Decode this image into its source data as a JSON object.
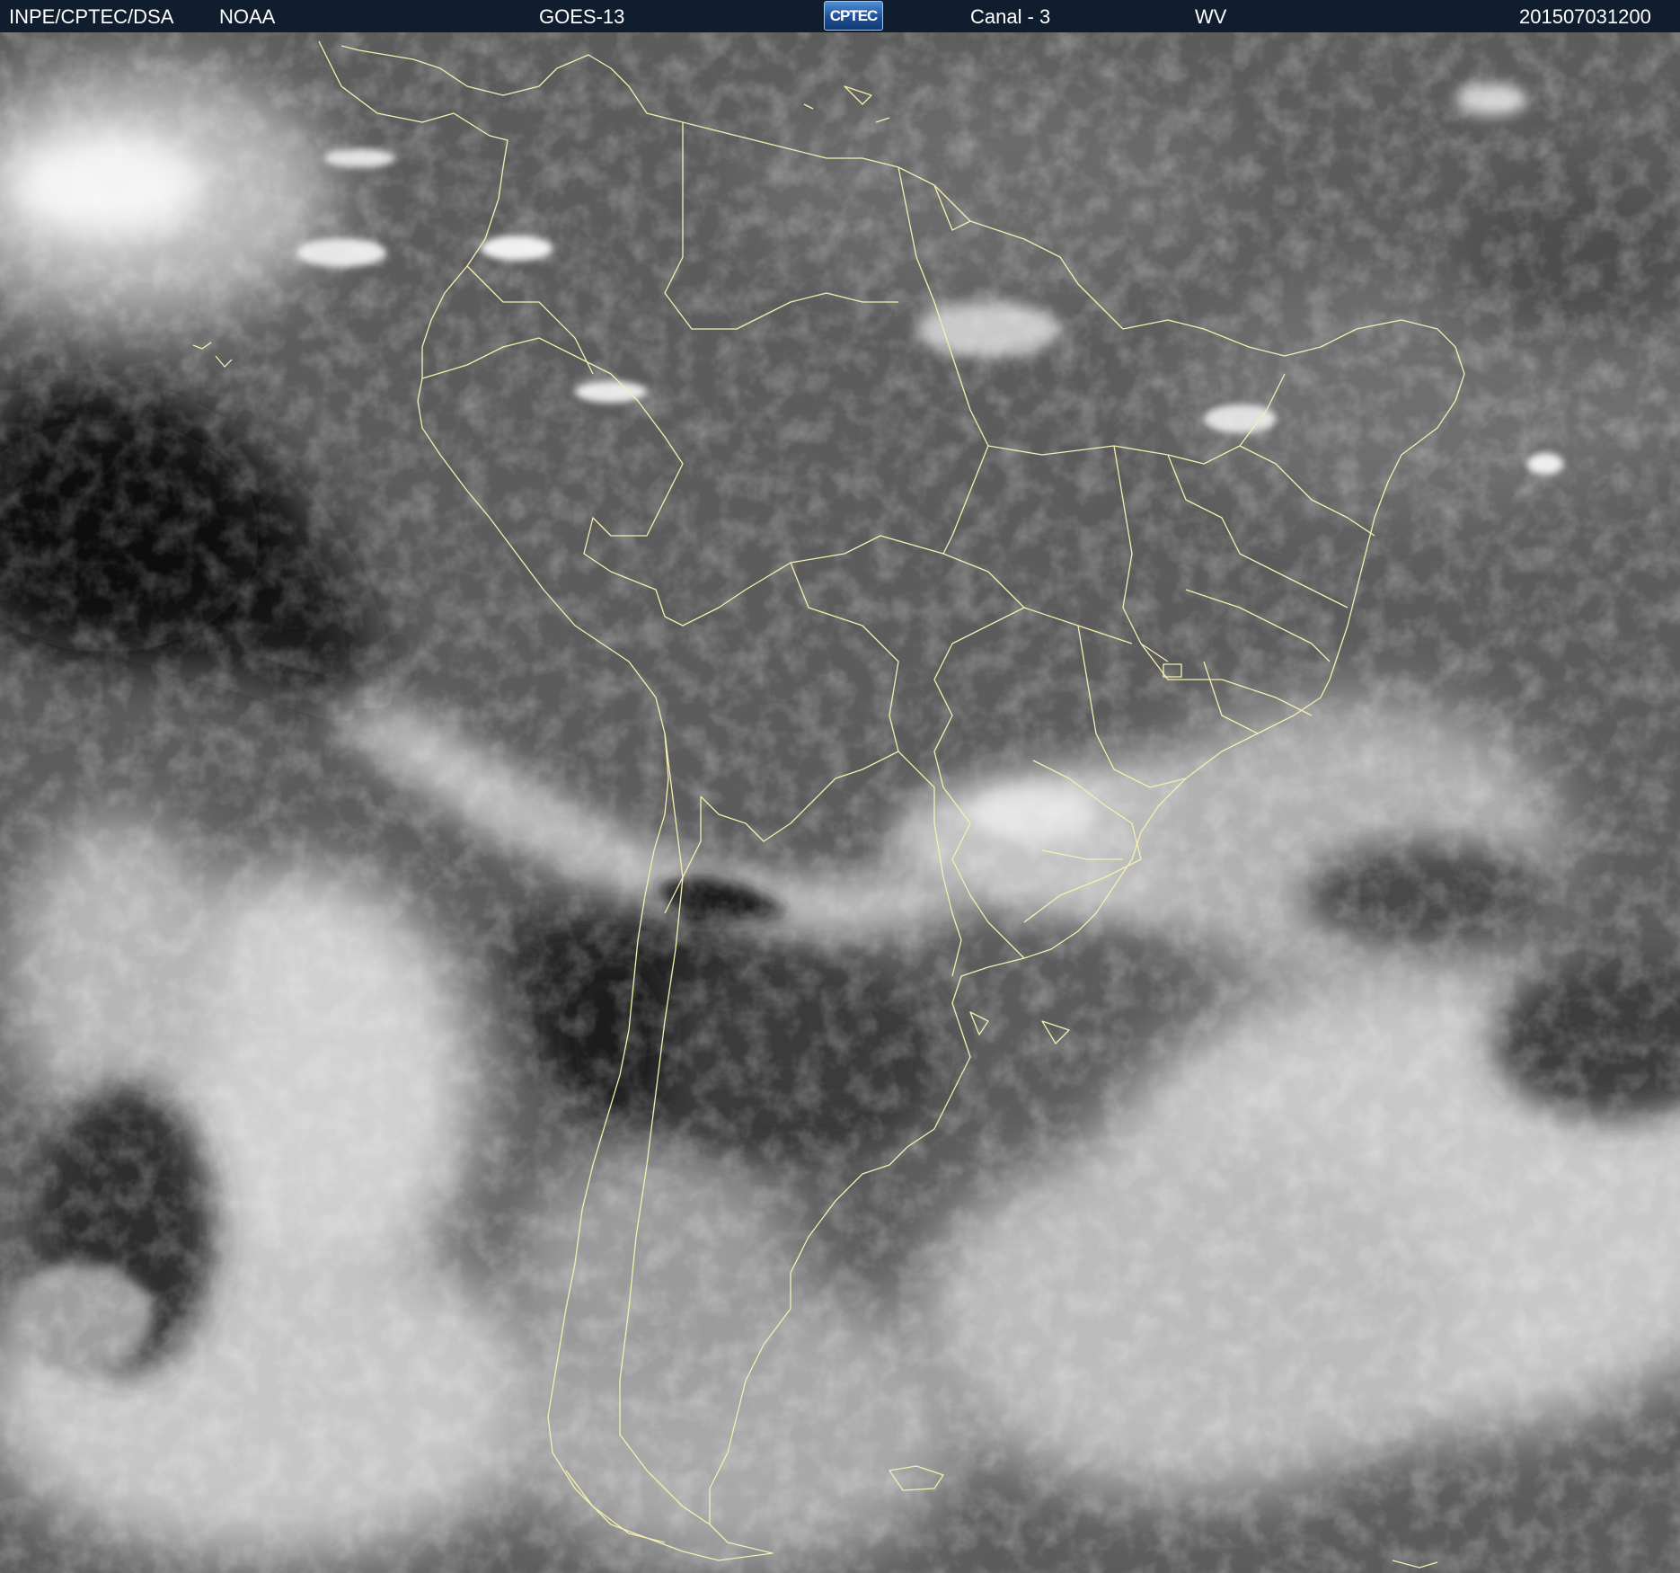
{
  "header": {
    "agency": "INPE/CPTEC/DSA",
    "provider": "NOAA",
    "satellite": "GOES-13",
    "logo_text": "CPTEC",
    "channel": "Canal - 3",
    "band": "WV",
    "timestamp": "201507031200"
  },
  "image": {
    "subject": "water vapor satellite image of South America",
    "coastline_color": "#f3f0b0",
    "header_background": "#0f1d2e"
  }
}
